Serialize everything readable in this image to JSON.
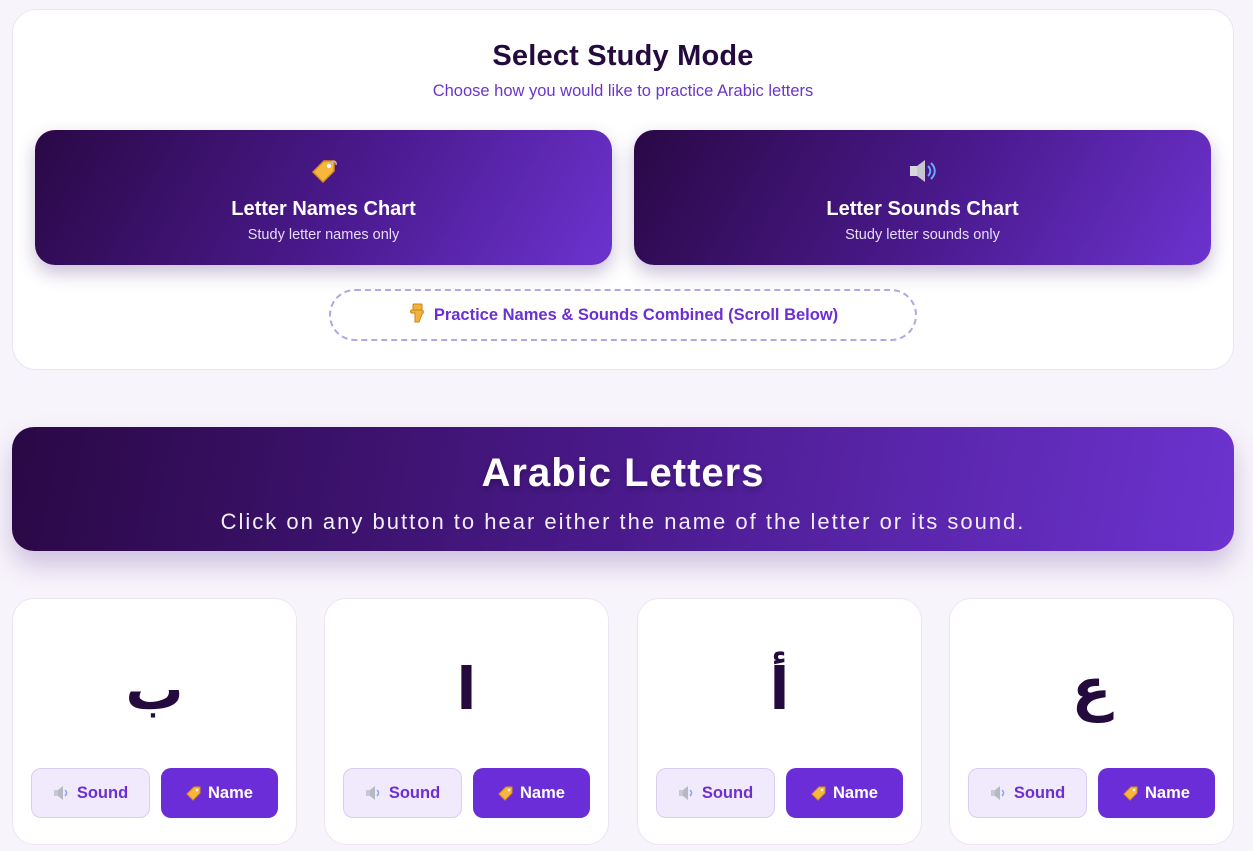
{
  "study_mode": {
    "title": "Select Study Mode",
    "subtitle": "Choose how you would like to practice Arabic letters",
    "cards": [
      {
        "icon": "tag-icon",
        "title": "Letter Names Chart",
        "description": "Study letter names only"
      },
      {
        "icon": "speaker-icon",
        "title": "Letter Sounds Chart",
        "description": "Study letter sounds only"
      }
    ],
    "combined_label": "Practice Names & Sounds Combined (Scroll Below)",
    "combined_icon": "pointing-down-hand-icon"
  },
  "hero": {
    "title": "Arabic Letters",
    "subtitle": "Click on any button to hear either the name of the letter or its sound."
  },
  "letters": [
    {
      "glyph": "ب",
      "sound_label": "Sound",
      "name_label": "Name"
    },
    {
      "glyph": "ا",
      "sound_label": "Sound",
      "name_label": "Name"
    },
    {
      "glyph": "أ",
      "sound_label": "Sound",
      "name_label": "Name"
    },
    {
      "glyph": "ع",
      "sound_label": "Sound",
      "name_label": "Name"
    }
  ],
  "colors": {
    "accent": "#6a2dd8",
    "gradient_start": "#2a0845",
    "gradient_end": "#6c33cf",
    "heading": "#240a3d"
  }
}
